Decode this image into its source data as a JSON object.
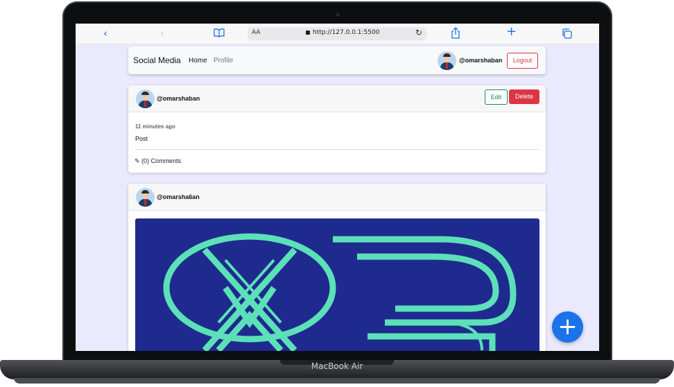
{
  "device": {
    "label": "MacBook Air"
  },
  "browser": {
    "url": "http://127.0.0.1:5500",
    "text_size_label": "AA"
  },
  "navbar": {
    "brand": "Social Media",
    "links": [
      "Home",
      "Profile"
    ],
    "username": "@omarshaban",
    "logout_label": "Logout"
  },
  "posts": [
    {
      "username": "@omarshaban",
      "edit_label": "Edit",
      "delete_label": "Delete",
      "time": "11 minutes ago",
      "body": "Post",
      "comments": "(0) Comments"
    },
    {
      "username": "@omarsha6an",
      "has_image": true
    }
  ],
  "colors": {
    "background": "#ebe9fd",
    "primary": "#1a73e8",
    "danger": "#dc3545",
    "success": "#198754",
    "image_bg": "#1f2a8f",
    "logo": "#5ce0b8"
  },
  "icons": {
    "back": "chevron-left-icon",
    "forward": "chevron-right-icon",
    "bookmarks": "book-icon",
    "share": "share-icon",
    "new_tab": "plus-icon",
    "tabs": "tabs-icon",
    "comment": "pencil-icon",
    "fab": "plus-icon"
  }
}
